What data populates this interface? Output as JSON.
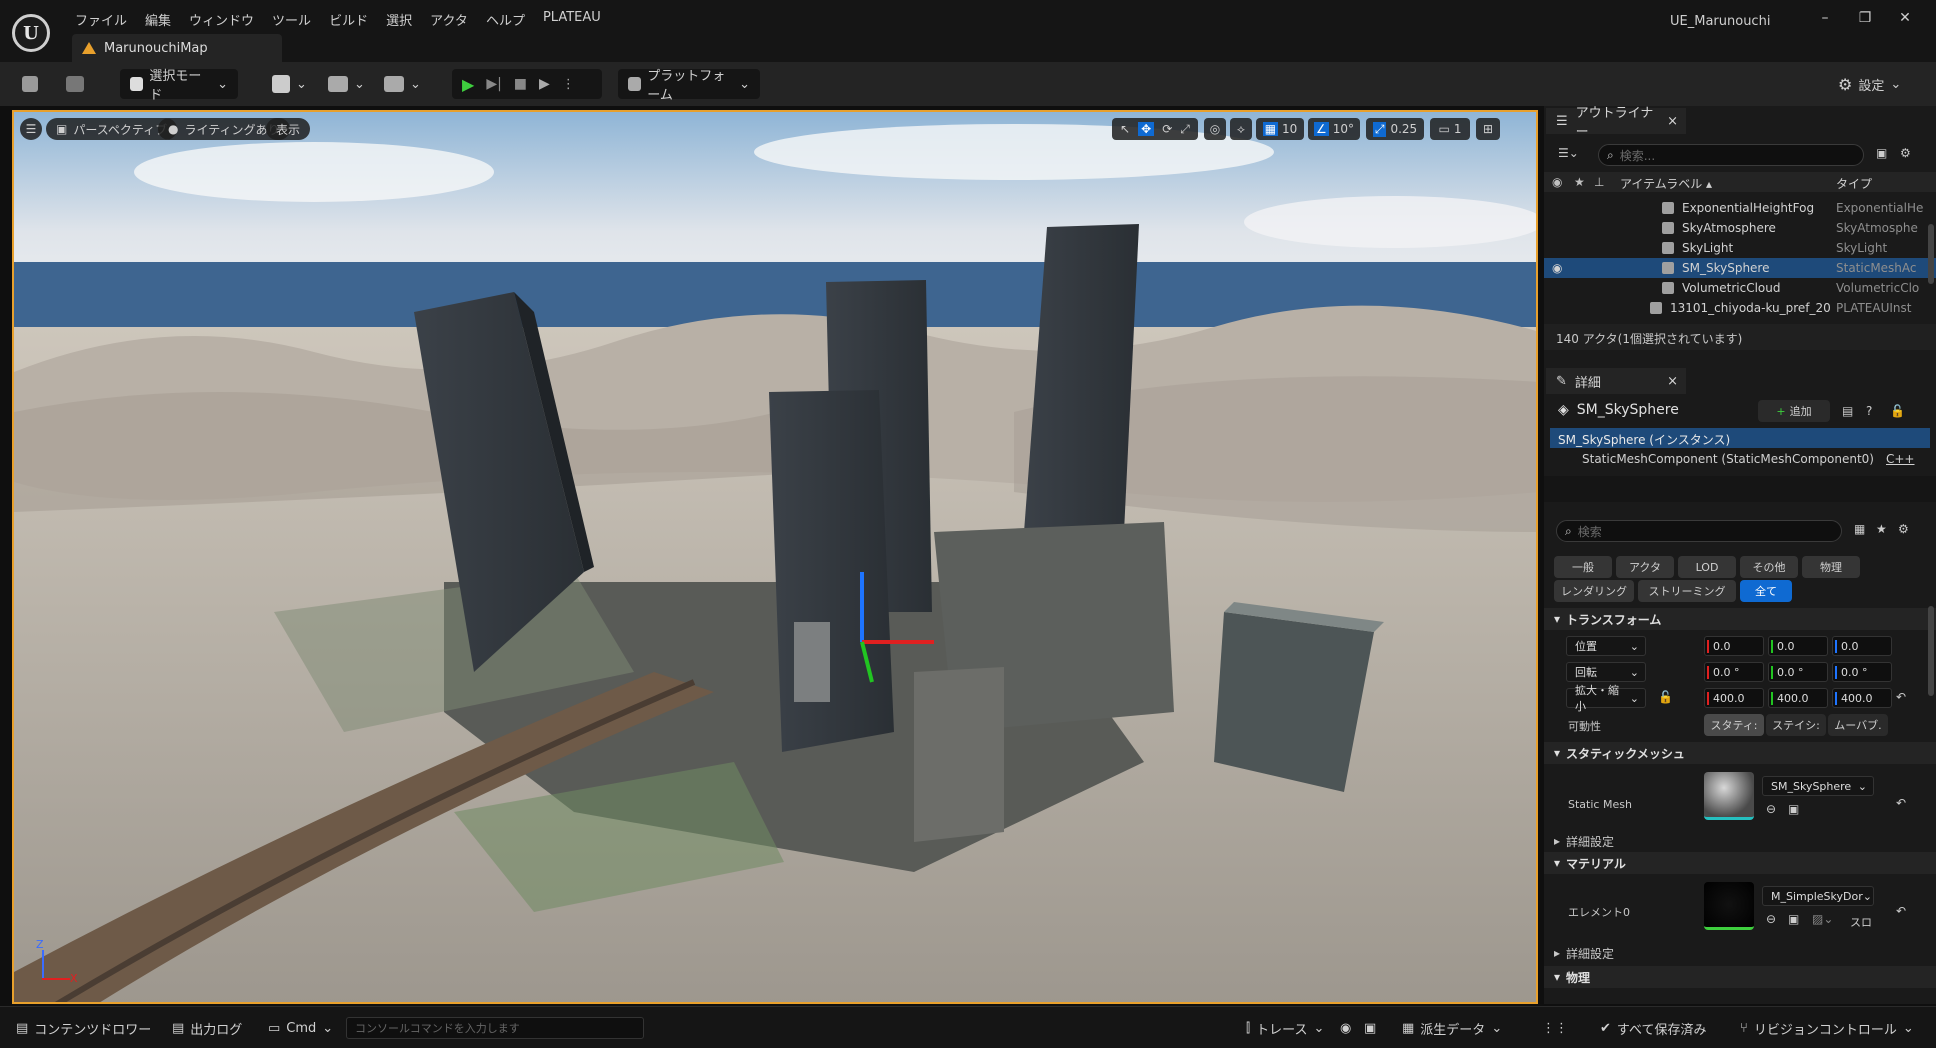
{
  "window": {
    "app_title": "UE_Marunouchi",
    "tab": "MarunouchiMap",
    "logo": "U"
  },
  "menu": [
    "ファイル",
    "編集",
    "ウィンドウ",
    "ツール",
    "ビルド",
    "選択",
    "アクタ",
    "ヘルプ",
    "PLATEAU"
  ],
  "toolbar": {
    "select_mode": "選択モード",
    "platform": "プラットフォーム",
    "settings": "設定"
  },
  "viewport": {
    "perspective": "パースペクティブ",
    "lighting": "ライティングあり",
    "show": "表示",
    "grid_snap": "10",
    "rotate_snap": "10°",
    "scale_snap": "0.25",
    "camera_speed": "1",
    "axis_z": "Z",
    "axis_x": "X"
  },
  "outliner": {
    "title": "アウトライナー",
    "search_placeholder": "検索...",
    "col_label": "アイテムラベル ▴",
    "col_type": "タイプ",
    "rows": [
      {
        "label": "ExponentialHeightFog",
        "type": "ExponentialHe"
      },
      {
        "label": "SkyAtmosphere",
        "type": "SkyAtmosphe"
      },
      {
        "label": "SkyLight",
        "type": "SkyLight"
      },
      {
        "label": "SM_SkySphere",
        "type": "StaticMeshAc"
      },
      {
        "label": "VolumetricCloud",
        "type": "VolumetricClo"
      },
      {
        "label": "13101_chiyoda-ku_pref_20",
        "type": "PLATEAUInst"
      }
    ],
    "status": "140 アクタ(1個選択されています)"
  },
  "details": {
    "title": "詳細",
    "object": "SM_SkySphere",
    "add": "追加",
    "instance": "SM_SkySphere (インスタンス)",
    "component": "StaticMeshComponent (StaticMeshComponent0)",
    "cpp": "C++",
    "search_placeholder": "検索",
    "filters_row1": [
      "一般",
      "アクタ",
      "LOD",
      "その他",
      "物理"
    ],
    "filters_row2": [
      "レンダリング",
      "ストリーミング",
      "全て"
    ],
    "transform": "トランスフォーム",
    "location": "位置",
    "rotation": "回転",
    "scale": "拡大・縮小",
    "location_values": [
      "0.0",
      "0.0",
      "0.0"
    ],
    "rotation_values": [
      "0.0 °",
      "0.0 °",
      "0.0 °"
    ],
    "scale_values": [
      "400.0",
      "400.0",
      "400.0"
    ],
    "mobility": "可動性",
    "mobility_options": [
      "スタティ:",
      "ステイシ:",
      "ムーバブ."
    ],
    "static_mesh_section": "スタティックメッシュ",
    "static_mesh_label": "Static Mesh",
    "static_mesh_value": "SM_SkySphere",
    "advanced": "詳細設定",
    "materials_section": "マテリアル",
    "element0": "エレメント0",
    "material_value": "M_SimpleSkyDor",
    "material_extra": "スロ",
    "advanced2": "詳細設定",
    "physics_section": "物理"
  },
  "statusbar": {
    "content_drawer": "コンテンツドロワー",
    "output_log": "出力ログ",
    "cmd": "Cmd",
    "console_placeholder": "コンソールコマンドを入力します",
    "trace": "トレース",
    "derived_data": "派生データ",
    "save_all": "すべて保存済み",
    "revision_control": "リビジョンコントロール"
  },
  "colors": {
    "accent_orange": "#e8a02c",
    "selection_blue": "#0f6ad2"
  }
}
